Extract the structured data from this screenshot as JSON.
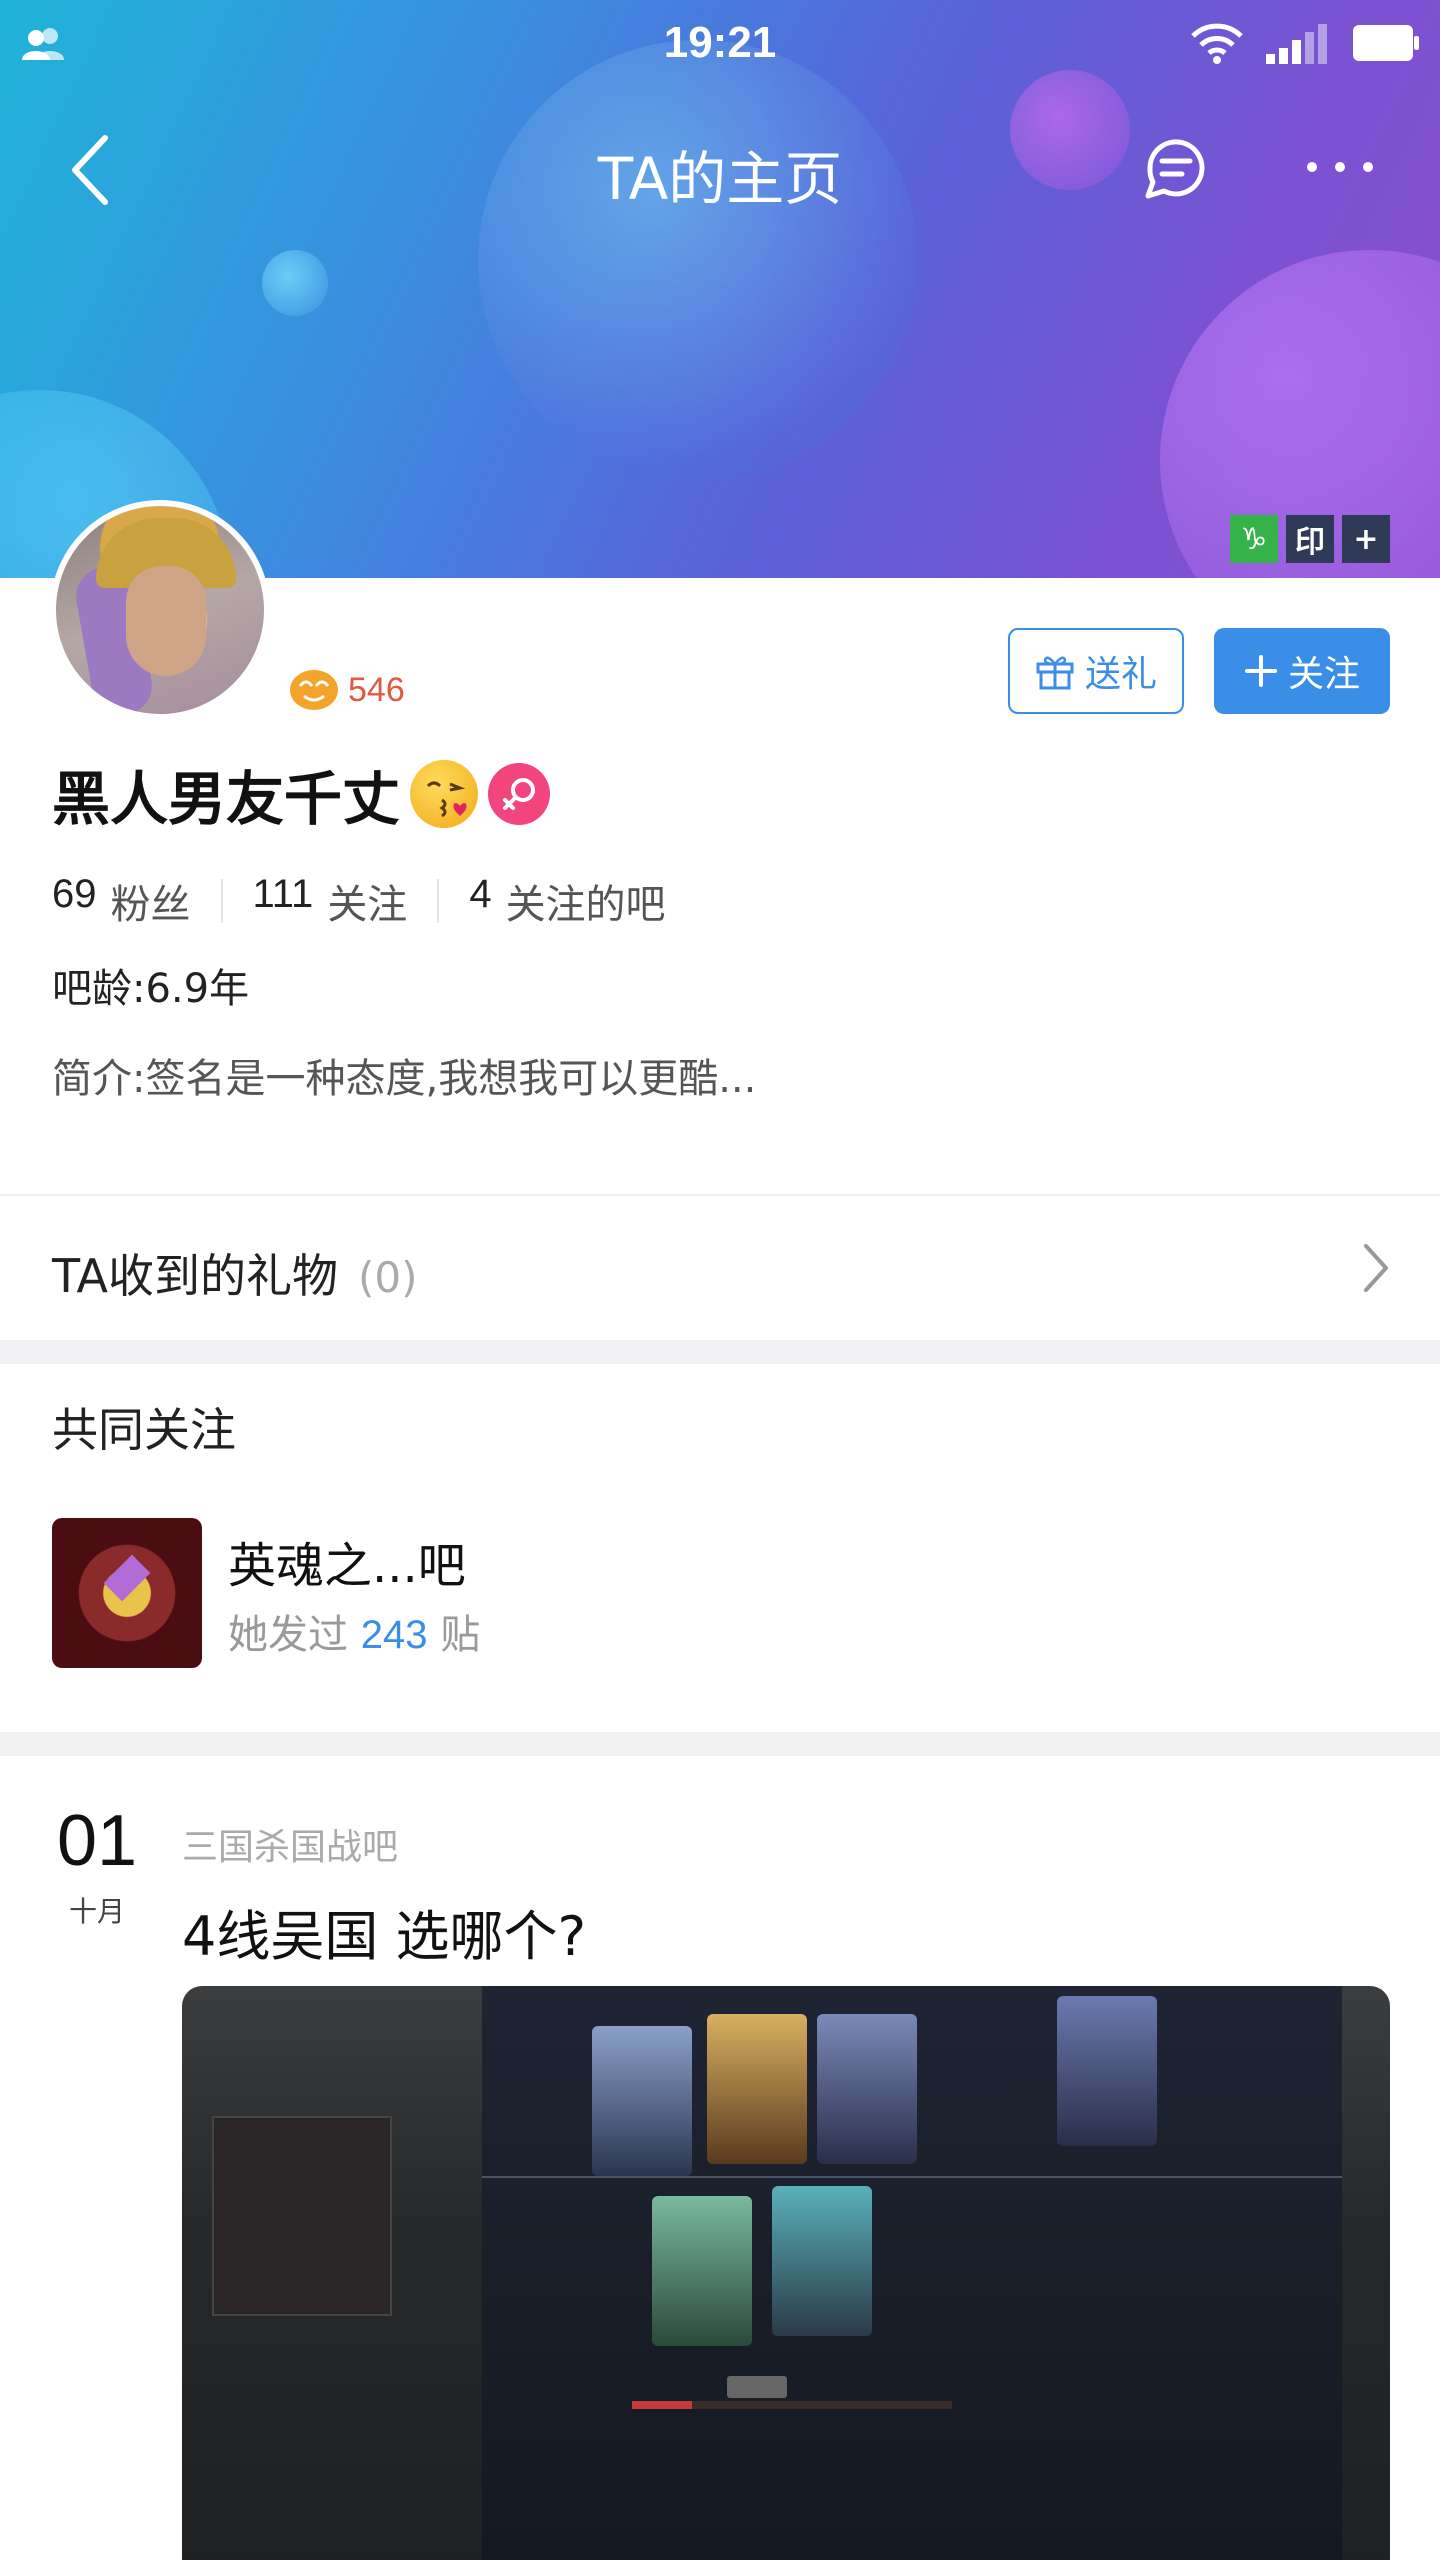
{
  "status_bar": {
    "time": "19:21"
  },
  "nav": {
    "title": "TA的主页"
  },
  "badges": [
    "♑",
    "印",
    "+"
  ],
  "profile": {
    "level": "546",
    "name": "黑人男友千丈",
    "emoji": "kissing-face-emoji",
    "gender": "female",
    "stats": [
      {
        "num": "69",
        "label": "粉丝"
      },
      {
        "num": "111",
        "label": "关注"
      },
      {
        "num": "4",
        "label": "关注的吧"
      }
    ],
    "age_label": "吧龄:",
    "age_value": "6.9年",
    "bio_label": "简介:",
    "bio_value": "签名是一种态度,我想我可以更酷..."
  },
  "actions": {
    "gift_label": "送礼",
    "follow_label": "关注"
  },
  "gifts": {
    "label": "TA收到的礼物",
    "count": "(0)"
  },
  "common": {
    "title": "共同关注",
    "forum_name": "英魂之...吧",
    "posts_prefix": "她发过",
    "posts_count": "243",
    "posts_suffix": "贴"
  },
  "post": {
    "day": "01",
    "month": "十月",
    "forum": "三国杀国战吧",
    "title": "4线吴国 选哪个?"
  },
  "colors": {
    "accent": "#3a8ee8",
    "level": "#e05a43",
    "female": "#f2457e"
  }
}
